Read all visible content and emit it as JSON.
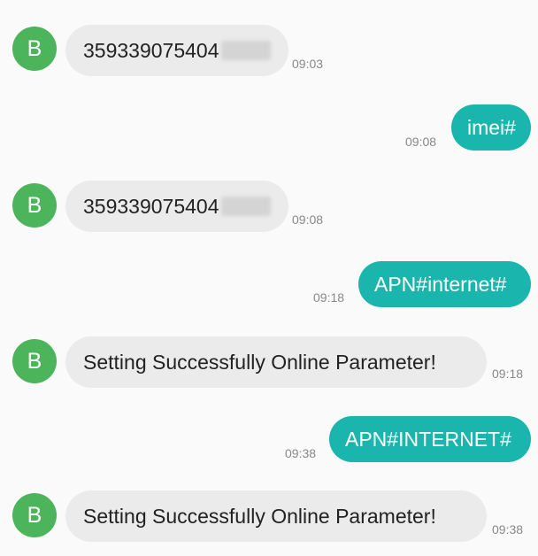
{
  "avatar_letter": "B",
  "messages": [
    {
      "direction": "incoming",
      "text": "359339075404",
      "time": "09:03",
      "redacted": true
    },
    {
      "direction": "outgoing",
      "text": "imei#",
      "time": "09:08"
    },
    {
      "direction": "incoming",
      "text": "359339075404",
      "time": "09:08",
      "redacted": true
    },
    {
      "direction": "outgoing",
      "text": "APN#internet#",
      "time": "09:18"
    },
    {
      "direction": "incoming",
      "text": "Setting Successfully Online Parameter!",
      "time": "09:18"
    },
    {
      "direction": "outgoing",
      "text": "APN#INTERNET#",
      "time": "09:38"
    },
    {
      "direction": "incoming",
      "text": "Setting Successfully Online Parameter!",
      "time": "09:38"
    }
  ],
  "colors": {
    "background": "#fafafa",
    "avatar": "#4cb45a",
    "incoming_bubble": "#ebebeb",
    "outgoing_bubble": "#1ab6ad",
    "timestamp": "#888888"
  }
}
